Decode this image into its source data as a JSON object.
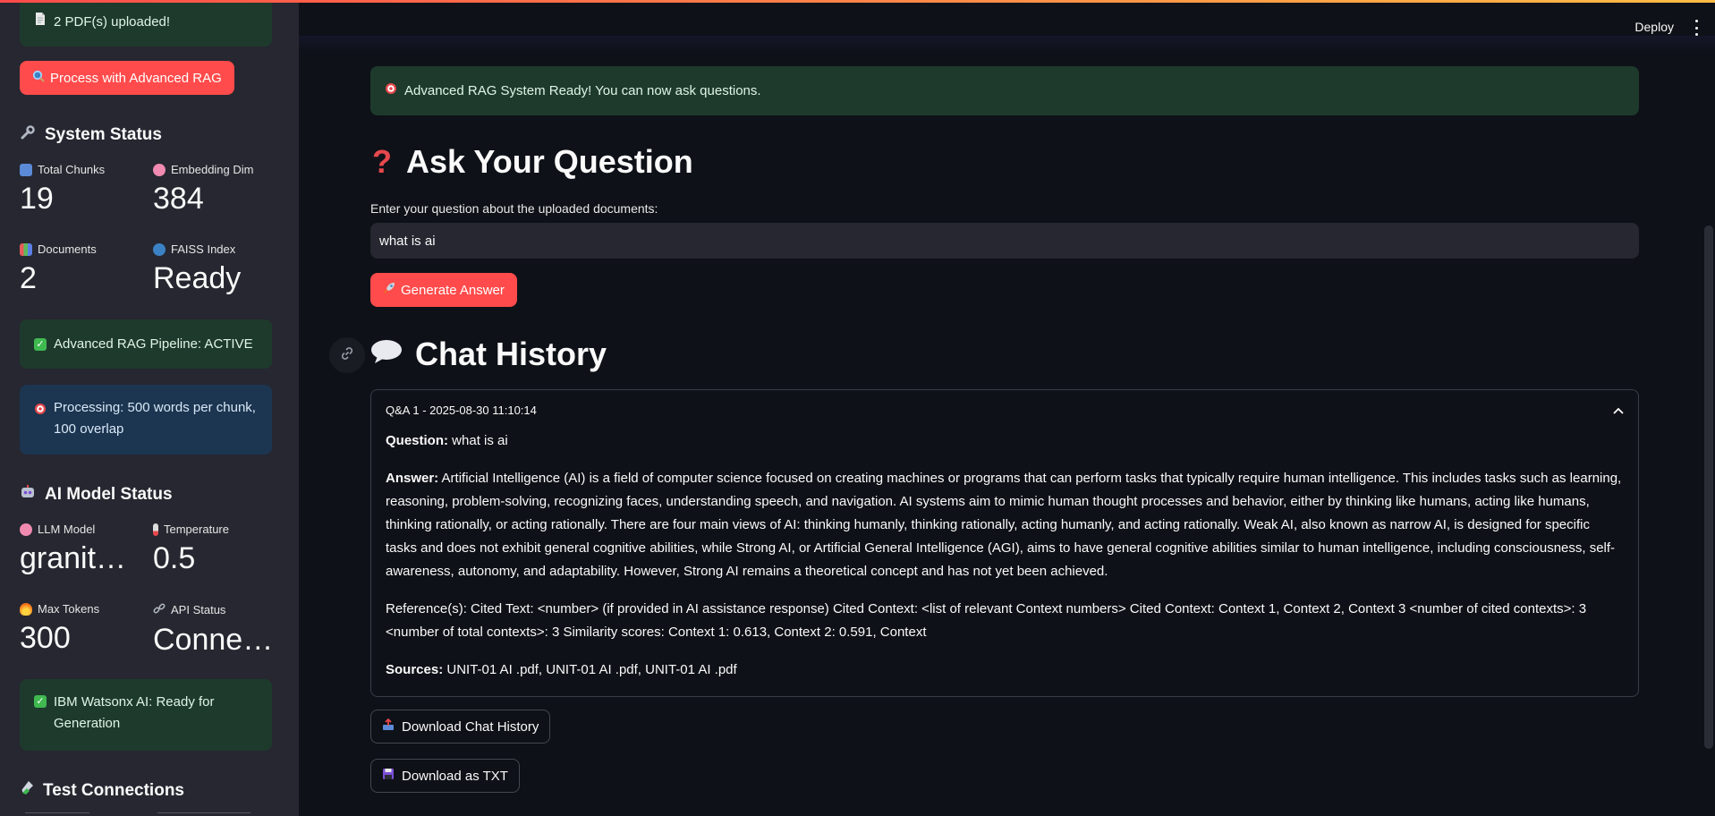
{
  "sidebar": {
    "upload_status": "2 PDF(s) uploaded!",
    "process_button": "Process with Advanced RAG",
    "system_status_title": "System Status",
    "metrics_system": [
      {
        "label": "Total Chunks",
        "value": "19",
        "icon": "bar-chart-icon"
      },
      {
        "label": "Embedding Dim",
        "value": "384",
        "icon": "brain-icon"
      },
      {
        "label": "Documents",
        "value": "2",
        "icon": "books-icon"
      },
      {
        "label": "FAISS Index",
        "value": "Ready",
        "icon": "magnifier-icon"
      }
    ],
    "pipeline_status": "Advanced RAG Pipeline: ACTIVE",
    "processing_info": "Processing: 500 words per chunk, 100 overlap",
    "ai_model_title": "AI Model Status",
    "metrics_model": [
      {
        "label": "LLM Model",
        "value": "granit…",
        "icon": "brain-icon"
      },
      {
        "label": "Temperature",
        "value": "0.5",
        "icon": "thermometer-icon"
      },
      {
        "label": "Max Tokens",
        "value": "300",
        "icon": "fire-icon"
      },
      {
        "label": "API Status",
        "value": "Conne…",
        "icon": "link-icon"
      }
    ],
    "watsonx_status": "IBM Watsonx AI: Ready for Generation",
    "test_connections_title": "Test Connections"
  },
  "header": {
    "deploy_label": "Deploy"
  },
  "main": {
    "ready_message": "Advanced RAG System Ready! You can now ask questions.",
    "ask_title": "Ask Your Question",
    "question_label": "Enter your question about the uploaded documents:",
    "question_value": "what is ai",
    "generate_button": "Generate Answer",
    "chat_history_title": "Chat History",
    "qa": {
      "header": "Q&A 1 - 2025-08-30 11:10:14",
      "question_label": "Question:",
      "question": "what is ai",
      "answer_label": "Answer:",
      "answer": "Artificial Intelligence (AI) is a field of computer science focused on creating machines or programs that can perform tasks that typically require human intelligence. This includes tasks such as learning, reasoning, problem-solving, recognizing faces, understanding speech, and navigation. AI systems aim to mimic human thought processes and behavior, either by thinking like humans, acting like humans, thinking rationally, or acting rationally. There are four main views of AI: thinking humanly, thinking rationally, acting humanly, and acting rationally. Weak AI, also known as narrow AI, is designed for specific tasks and does not exhibit general cognitive abilities, while Strong AI, or Artificial General Intelligence (AGI), aims to have general cognitive abilities similar to human intelligence, including consciousness, self-awareness, autonomy, and adaptability. However, Strong AI remains a theoretical concept and has not yet been achieved.",
      "references": "Reference(s): Cited Text: <number> (if provided in AI assistance response) Cited Context: <list of relevant Context numbers> Cited Context: Context 1, Context 2, Context 3 <number of cited contexts>: 3 <number of total contexts>: 3 Similarity scores: Context 1: 0.613, Context 2: 0.591, Context",
      "sources_label": "Sources:",
      "sources": "UNIT-01 AI .pdf, UNIT-01 AI .pdf, UNIT-01 AI .pdf"
    },
    "download_history_button": "Download Chat History",
    "download_txt_button": "Download as TXT"
  },
  "colors": {
    "primary": "#ff4b4b",
    "success_bg": "#1e3a2c",
    "info_bg": "#1c3550",
    "sidebar_bg": "#262730",
    "main_bg": "#0e1117"
  }
}
